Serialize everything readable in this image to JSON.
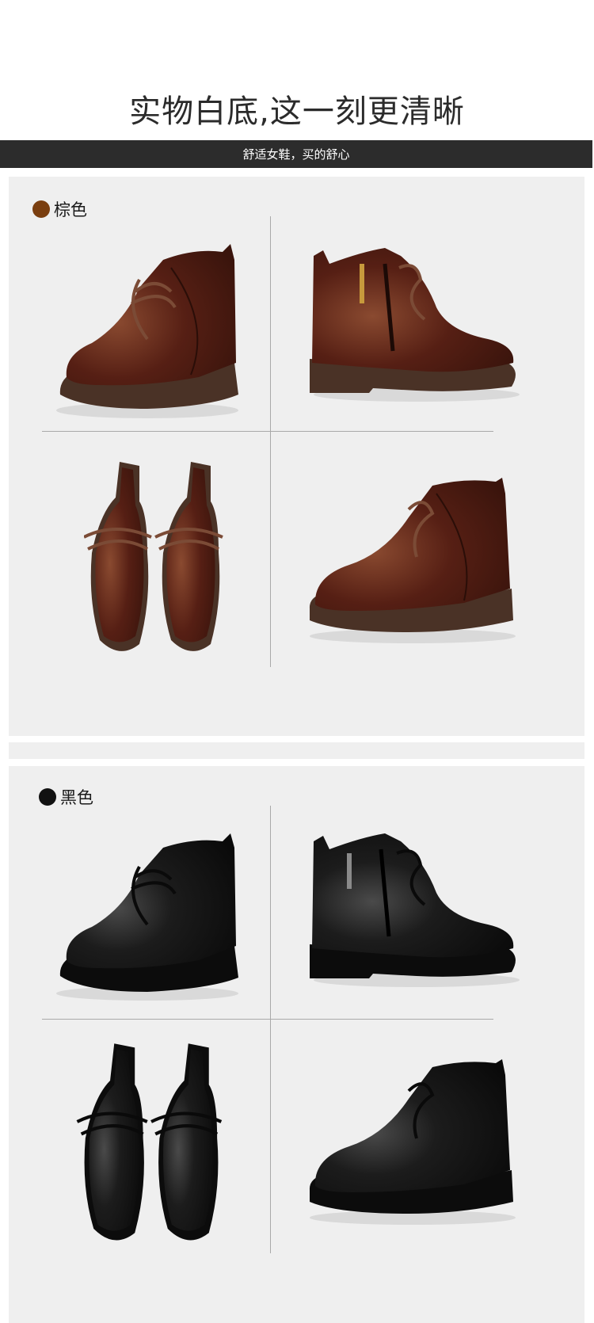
{
  "header": {
    "headline": "实物白底,这一刻更清晰",
    "banner": "舒适女鞋，买的舒心"
  },
  "variants": [
    {
      "label": "棕色",
      "color": "#7a3e0f",
      "shoe_color": "#4a1c12",
      "sole_color": "#4a3226"
    },
    {
      "label": "黑色",
      "color": "#111111",
      "shoe_color": "#141414",
      "sole_color": "#0c0c0c"
    }
  ],
  "views": [
    "side-view-left",
    "side-view-zipper",
    "top-view-pair",
    "side-view-right"
  ]
}
